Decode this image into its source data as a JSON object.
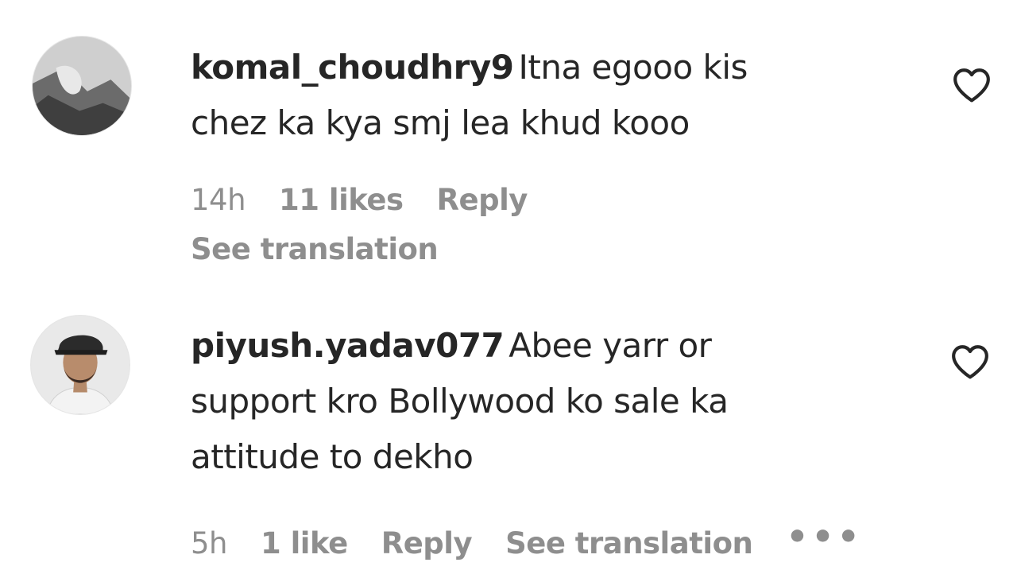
{
  "comments": [
    {
      "username": "komal_choudhry9",
      "text_line1": "Itna egooo kis",
      "text_line2": "chez ka kya smj lea khud kooo",
      "time": "14h",
      "likes": "11 likes",
      "reply": "Reply",
      "translate": "See translation",
      "avatar_icon": "avatar-komal",
      "like_icon": "heart-outline-icon"
    },
    {
      "username": "piyush.yadav077",
      "text_line1": "Abee yarr or",
      "text_line2": "support kro Bollywood ko sale ka",
      "text_line3": "attitude to dekho",
      "time": "5h",
      "likes": "1 like",
      "reply": "Reply",
      "translate": "See translation",
      "more": "•••",
      "avatar_icon": "avatar-piyush",
      "like_icon": "heart-outline-icon"
    }
  ],
  "colors": {
    "text": "#262626",
    "meta": "#8e8e8e",
    "background": "#ffffff"
  }
}
